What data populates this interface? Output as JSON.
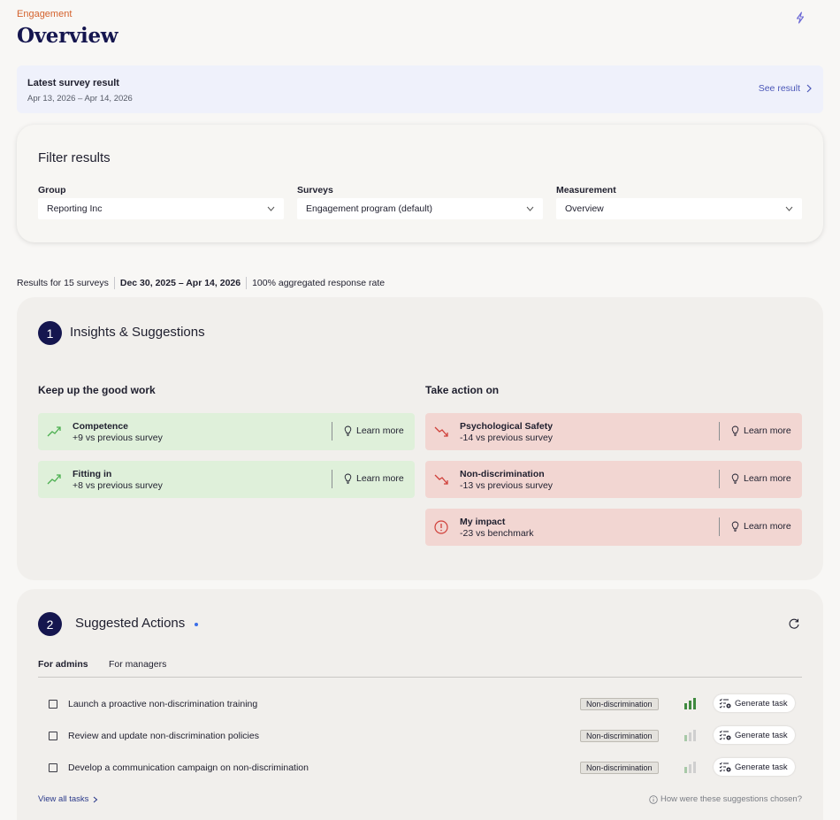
{
  "header": {
    "eyebrow": "Engagement",
    "title": "Overview",
    "top_icon": "bolt-icon"
  },
  "survey_banner": {
    "label": "Latest survey result",
    "dates": "Apr 13, 2026 – Apr 14, 2026",
    "link": "See result"
  },
  "filters": {
    "title": "Filter results",
    "group": {
      "label": "Group",
      "value": "Reporting Inc"
    },
    "surveys": {
      "label": "Surveys",
      "value": "Engagement program (default)"
    },
    "measurement": {
      "label": "Measurement",
      "value": "Overview"
    }
  },
  "results": {
    "count": "Results for 15 surveys",
    "range": "Dec 30, 2025 – Apr 14, 2026",
    "rate": "100% aggregated response rate"
  },
  "insights": {
    "step": "1",
    "title": "Insights & Suggestions",
    "good_title": "Keep up the good work",
    "bad_title": "Take action on",
    "learn_label": "Learn more",
    "good": [
      {
        "name": "Competence",
        "delta": "+9 vs previous survey",
        "icon": "trend-up-icon"
      },
      {
        "name": "Fitting in",
        "delta": "+8 vs previous survey",
        "icon": "trend-up-icon"
      }
    ],
    "bad": [
      {
        "name": "Psychological Safety",
        "delta": "-14 vs previous survey",
        "icon": "trend-down-icon"
      },
      {
        "name": "Non-discrimination",
        "delta": "-13 vs previous survey",
        "icon": "trend-down-icon"
      },
      {
        "name": "My impact",
        "delta": "-23 vs benchmark",
        "icon": "alert-circle-icon"
      }
    ],
    "colors": {
      "good_bg": "#dff0da",
      "bad_bg": "#f2d6d2",
      "good_icon": "#4caf50",
      "bad_icon": "#d0403a"
    }
  },
  "actions": {
    "step": "2",
    "title": "Suggested Actions",
    "tabs": [
      "For admins",
      "For managers"
    ],
    "generate_label": "Generate task",
    "tasks": [
      {
        "name": "Launch a proactive non-discrimination training",
        "tag": "Non-discrimination",
        "strength": "high"
      },
      {
        "name": "Review and update non-discrimination policies",
        "tag": "Non-discrimination",
        "strength": "low"
      },
      {
        "name": "Develop a communication campaign on non-discrimination",
        "tag": "Non-discrimination",
        "strength": "low"
      }
    ],
    "view_all": "View all tasks",
    "how_chosen": "How were these suggestions chosen?"
  }
}
